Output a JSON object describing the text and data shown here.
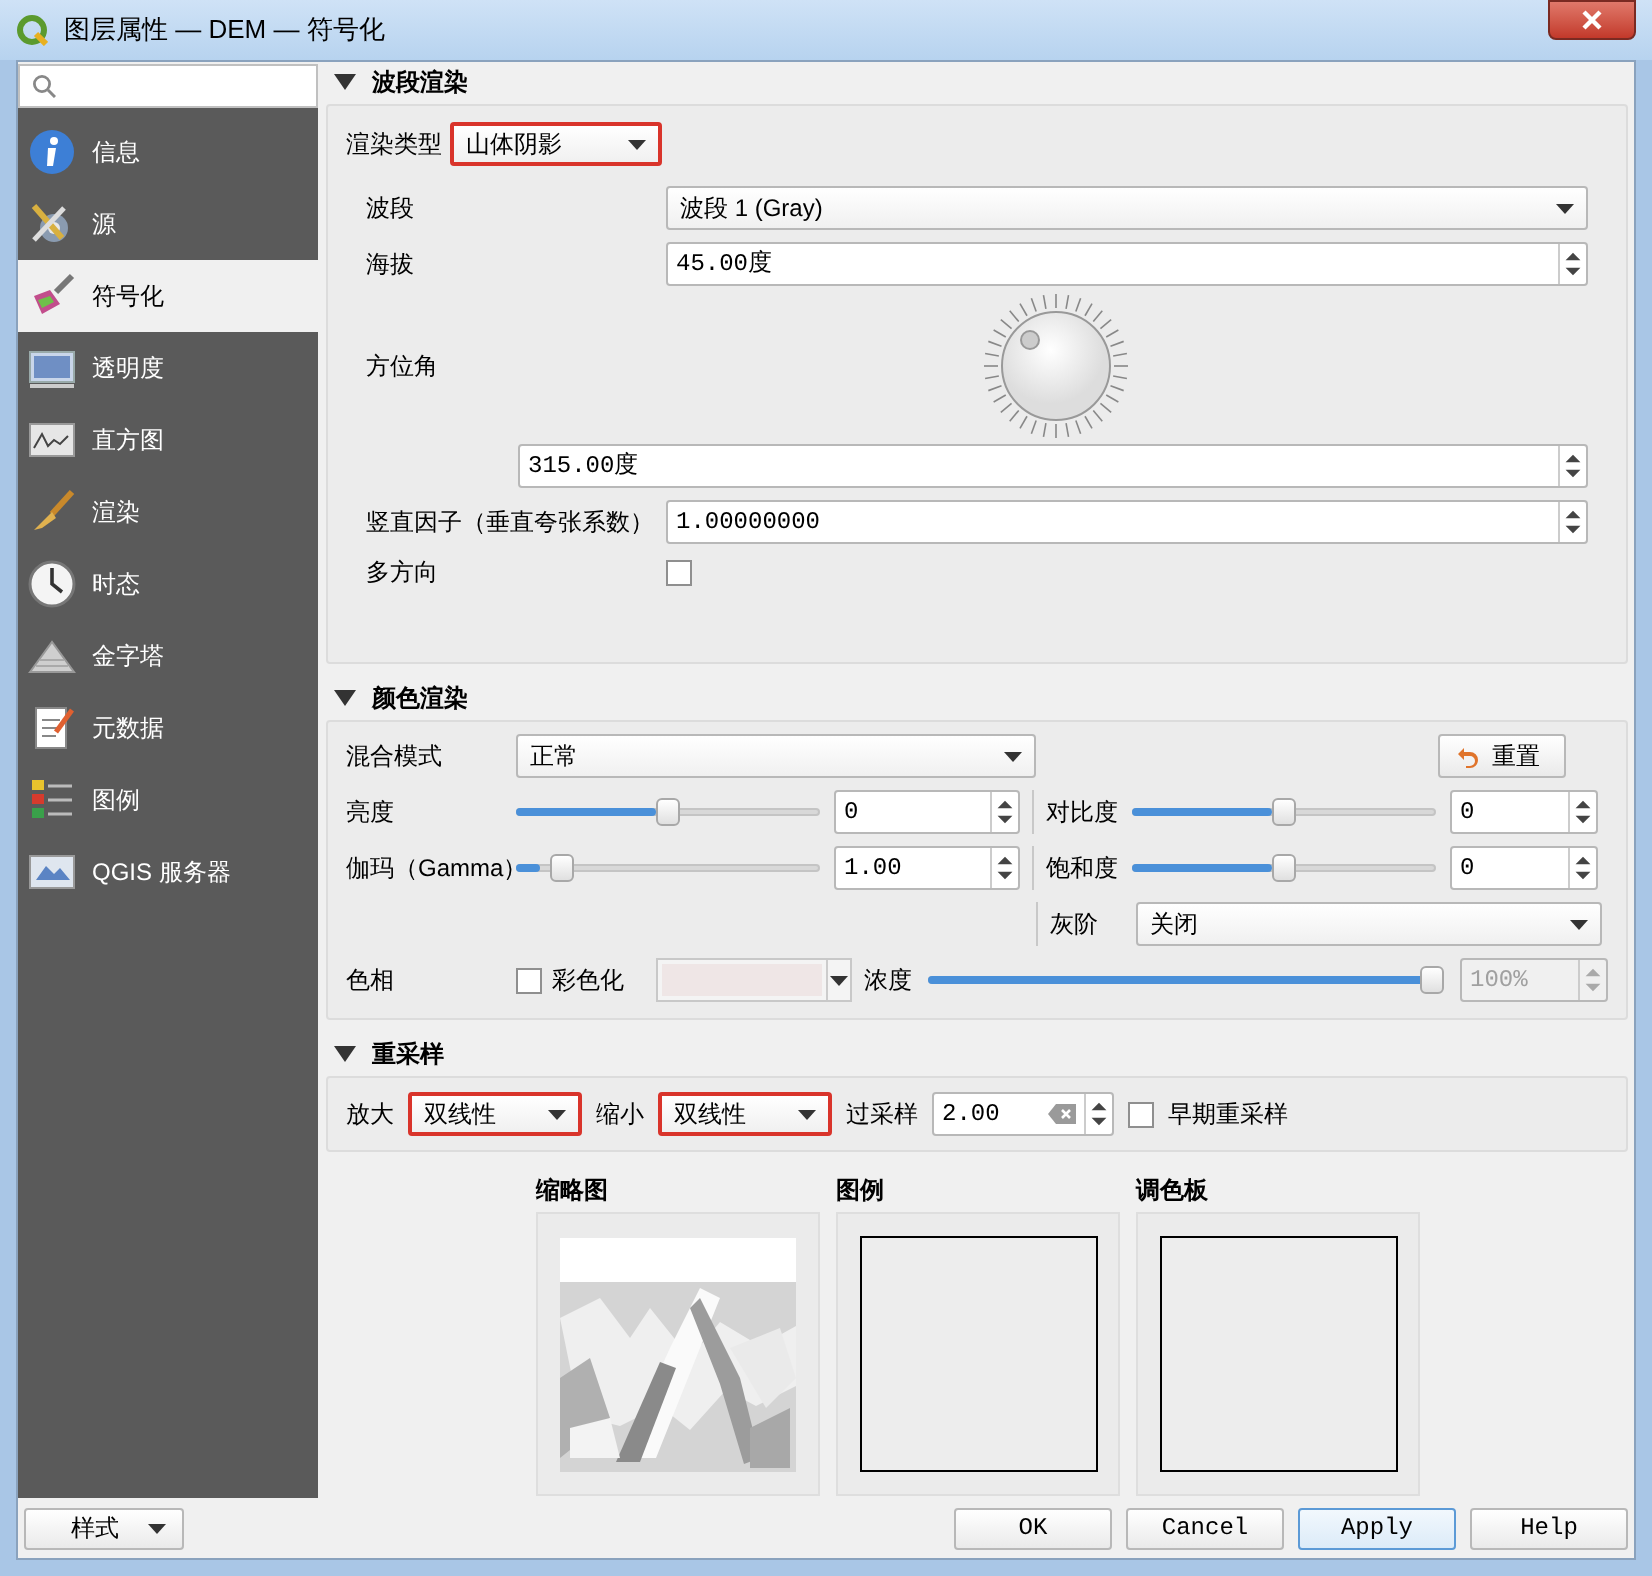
{
  "window": {
    "title": "图层属性 — DEM — 符号化"
  },
  "sidebar": {
    "items": [
      {
        "label": "信息",
        "selected": false
      },
      {
        "label": "源",
        "selected": false
      },
      {
        "label": "符号化",
        "selected": true
      },
      {
        "label": "透明度",
        "selected": false
      },
      {
        "label": "直方图",
        "selected": false
      },
      {
        "label": "渲染",
        "selected": false
      },
      {
        "label": "时态",
        "selected": false
      },
      {
        "label": "金字塔",
        "selected": false
      },
      {
        "label": "元数据",
        "selected": false
      },
      {
        "label": "图例",
        "selected": false
      },
      {
        "label": "QGIS 服务器",
        "selected": false
      }
    ]
  },
  "band_rendering": {
    "title": "波段渲染",
    "expanded": true,
    "render_type": {
      "label": "渲染类型",
      "value": "山体阴影",
      "highlighted": true
    },
    "band": {
      "label": "波段",
      "value": "波段 1 (Gray)"
    },
    "altitude": {
      "label": "海拔",
      "value": "45.00度"
    },
    "azimuth": {
      "label": "方位角",
      "value": "315.00度"
    },
    "z_factor": {
      "label": "竖直因子（垂直夸张系数）",
      "value": "1.00000000"
    },
    "multidirectional": {
      "label": "多方向",
      "checked": false
    }
  },
  "color_rendering": {
    "title": "颜色渲染",
    "expanded": true,
    "blend_mode": {
      "label": "混合模式",
      "value": "正常"
    },
    "reset_button": "重置",
    "brightness": {
      "label": "亮度",
      "level": 0.5,
      "value": "0"
    },
    "contrast": {
      "label": "对比度",
      "level": 0.5,
      "value": "0"
    },
    "gamma": {
      "label": "伽玛（Gamma）",
      "level": 0.12,
      "value": "1.00"
    },
    "saturation": {
      "label": "饱和度",
      "level": 0.5,
      "value": "0"
    },
    "grayscale": {
      "label": "灰阶",
      "value": "关闭"
    },
    "hue": {
      "label": "色相",
      "colorize": {
        "label": "彩色化",
        "checked": false
      },
      "strength": {
        "label": "浓度",
        "level": 1,
        "value": "100%",
        "disabled": true
      }
    }
  },
  "resampling": {
    "title": "重采样",
    "expanded": true,
    "zoomed_in": {
      "label": "放大",
      "value": "双线性",
      "highlighted": true
    },
    "zoomed_out": {
      "label": "缩小",
      "value": "双线性",
      "highlighted": true
    },
    "oversampling": {
      "label": "过采样",
      "value": "2.00"
    },
    "early_resampling": {
      "label": "早期重采样",
      "checked": false
    }
  },
  "previews": [
    {
      "title": "缩略图",
      "kind": "thumbnail"
    },
    {
      "title": "图例",
      "kind": "empty"
    },
    {
      "title": "调色板",
      "kind": "empty"
    }
  ],
  "style_menu": "样式",
  "buttons": [
    {
      "label": "OK",
      "default": false
    },
    {
      "label": "Cancel",
      "default": false
    },
    {
      "label": "Apply",
      "default": true
    },
    {
      "label": "Help",
      "default": false
    }
  ]
}
